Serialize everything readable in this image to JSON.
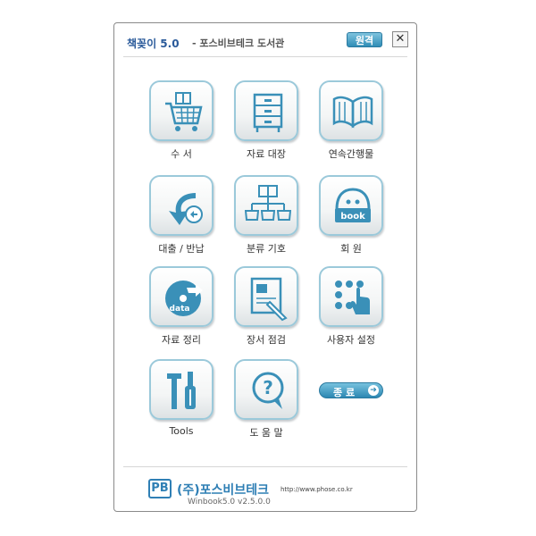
{
  "window": {
    "title_app": "책꽂이 5.0",
    "title_sub": "- 포스비브테크 도서관",
    "remote_label": "원격",
    "close_glyph": "✕"
  },
  "menu": [
    {
      "label": "수    서",
      "icon": "shopping-cart-icon"
    },
    {
      "label": "자료 대장",
      "icon": "cabinet-icon"
    },
    {
      "label": "연속간행물",
      "icon": "open-book-icon"
    },
    {
      "label": "대출 / 반납",
      "icon": "return-arrow-icon"
    },
    {
      "label": "분류 기호",
      "icon": "classification-tree-icon"
    },
    {
      "label": "회    원",
      "icon": "member-book-icon"
    },
    {
      "label": "자료 정리",
      "icon": "data-disc-icon"
    },
    {
      "label": "장서 점검",
      "icon": "inspection-pen-icon"
    },
    {
      "label": "사용자 설정",
      "icon": "touch-settings-icon"
    },
    {
      "label": "Tools",
      "icon": "tools-icon"
    },
    {
      "label": "도 움 말",
      "icon": "help-icon"
    }
  ],
  "exit": {
    "label": "종 료",
    "arrow": "➔"
  },
  "footer": {
    "logo_text": "PB",
    "company": "(주)포스비브테크",
    "url": "http://www.phose.co.kr",
    "version": "Winbook5.0 v2.5.0.0"
  },
  "colors": {
    "accent": "#2f8db6",
    "tile_border": "#9bc9da",
    "icon": "#3a90b8"
  }
}
